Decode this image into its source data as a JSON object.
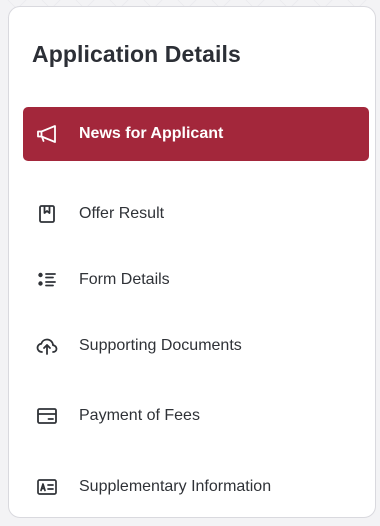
{
  "panel": {
    "title": "Application Details"
  },
  "nav": {
    "items": [
      {
        "label": "News for Applicant",
        "icon": "megaphone-icon",
        "active": true
      },
      {
        "label": "Offer Result",
        "icon": "bookmark-box-icon",
        "active": false
      },
      {
        "label": "Form Details",
        "icon": "list-icon",
        "active": false
      },
      {
        "label": "Supporting Documents",
        "icon": "cloud-upload-icon",
        "active": false
      },
      {
        "label": "Payment of Fees",
        "icon": "credit-card-icon",
        "active": false
      },
      {
        "label": "Supplementary Information",
        "icon": "id-card-icon",
        "active": false
      }
    ]
  },
  "colors": {
    "active_background": "#a3273b",
    "active_text": "#ffffff",
    "text": "#2f3237",
    "title": "#2c2f36"
  }
}
